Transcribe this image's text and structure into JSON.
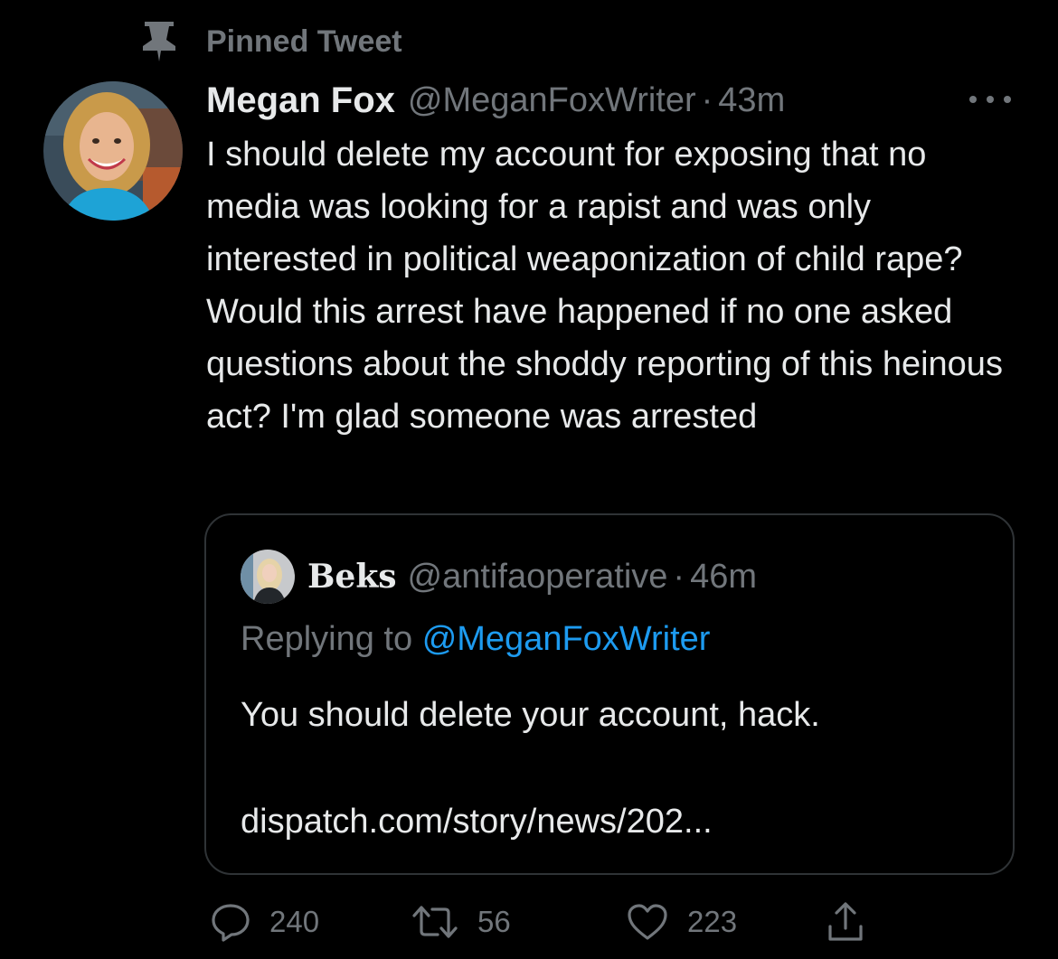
{
  "pinned": {
    "label": "Pinned Tweet",
    "icon": "pin-icon"
  },
  "tweet": {
    "author_name": "Megan Fox",
    "author_handle": "@MeganFoxWriter",
    "separator": "·",
    "time": "43m",
    "text": "I should delete my account for exposing that no media was looking for a rapist and was only interested in political weaponization of child rape? Would this arrest have happened if no one asked questions about the shoddy reporting of this heinous act? I'm glad someone was arrested"
  },
  "quote": {
    "author_name": "Beks",
    "author_handle": "@antifaoperative",
    "separator": "·",
    "time": "46m",
    "replying_prefix": "Replying to",
    "replying_to": "@MeganFoxWriter",
    "text": "You should delete your account, hack.",
    "link": "dispatch.com/story/news/202..."
  },
  "actions": {
    "reply_count": "240",
    "retweet_count": "56",
    "like_count": "223"
  },
  "colors": {
    "background": "#000000",
    "text_primary": "#e7e9ea",
    "text_secondary": "#71767b",
    "accent": "#1d9bf0",
    "border": "#2f3336"
  }
}
